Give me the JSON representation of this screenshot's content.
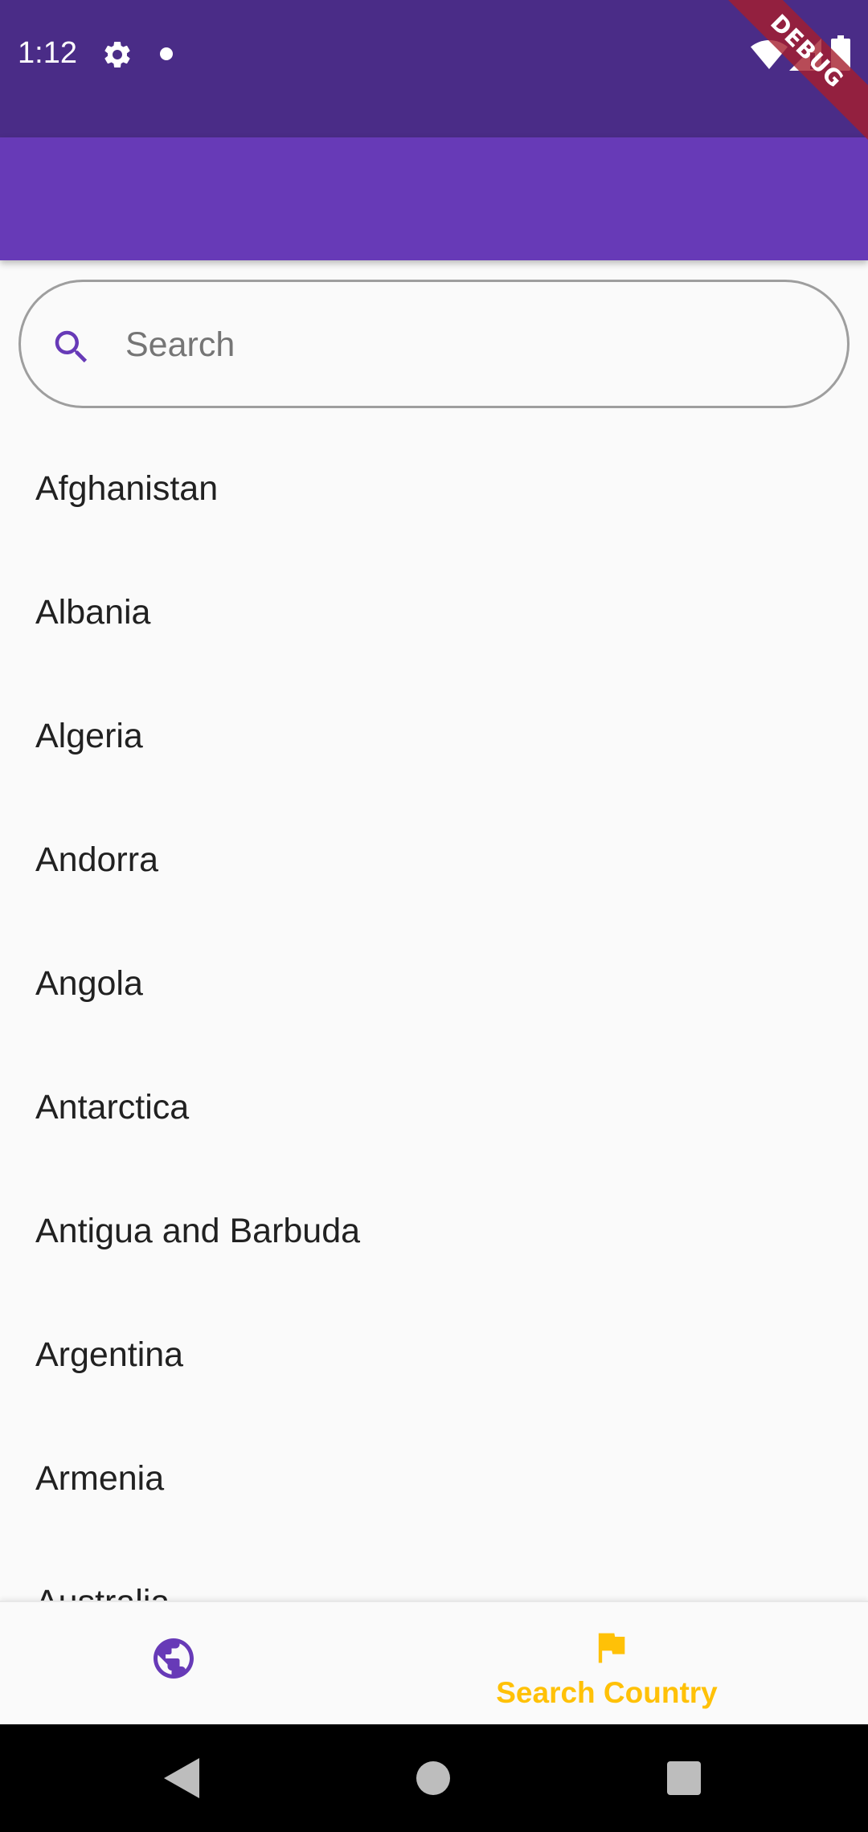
{
  "status_bar": {
    "time": "1:12",
    "icons": [
      "gear-icon",
      "notification-dot-icon",
      "wifi-icon",
      "signal-icon",
      "battery-icon"
    ]
  },
  "debug_banner": {
    "label": "DEBUG"
  },
  "colors": {
    "status_bar": "#4a2c87",
    "app_bar": "#673ab7",
    "accent_purple": "#673ab7",
    "active_nav": "#ffc107",
    "debug_banner": "#a51e2d"
  },
  "search": {
    "placeholder": "Search",
    "value": "",
    "icon": "search-icon"
  },
  "countries": [
    "Afghanistan",
    "Albania",
    "Algeria",
    "Andorra",
    "Angola",
    "Antarctica",
    "Antigua and Barbuda",
    "Argentina",
    "Armenia",
    "Australia"
  ],
  "bottom_nav": {
    "items": [
      {
        "icon": "globe-icon",
        "label": "",
        "active": false
      },
      {
        "icon": "flag-icon",
        "label": "Search Country",
        "active": true
      }
    ]
  },
  "system_nav": {
    "buttons": [
      "back",
      "home",
      "recents"
    ]
  }
}
